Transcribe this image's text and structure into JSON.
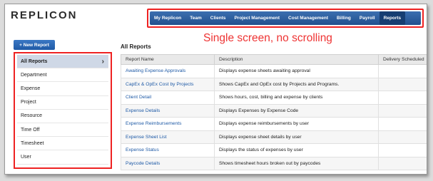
{
  "brand": {
    "logo_text": "REPLICON"
  },
  "nav": {
    "items": [
      {
        "label": "My Replicon"
      },
      {
        "label": "Team"
      },
      {
        "label": "Clients"
      },
      {
        "label": "Project Management"
      },
      {
        "label": "Cost Management"
      },
      {
        "label": "Billing"
      },
      {
        "label": "Payroll"
      },
      {
        "label": "Reports"
      }
    ],
    "active": "Reports"
  },
  "annotation": {
    "text": "Single screen, no scrolling"
  },
  "toolbar": {
    "new_report_label": "+ New Report"
  },
  "sidebar": {
    "items": [
      {
        "label": "All Reports"
      },
      {
        "label": "Department"
      },
      {
        "label": "Expense"
      },
      {
        "label": "Project"
      },
      {
        "label": "Resource"
      },
      {
        "label": "Time Off"
      },
      {
        "label": "Timesheet"
      },
      {
        "label": "User"
      }
    ]
  },
  "main": {
    "title": "All Reports",
    "columns": [
      "Report Name",
      "Description",
      "Delivery Scheduled"
    ],
    "rows": [
      {
        "name": "Awaiting Expense Approvals",
        "description": "Displays expense sheets awaiting approval"
      },
      {
        "name": "CapEx & OpEx Cost by Projects",
        "description": "Shows CapEx and OpEx cost by Projects and Programs."
      },
      {
        "name": "Client Detail",
        "description": "Shows hours, cost, billing and expense by clients"
      },
      {
        "name": "Expense Details",
        "description": "Displays Expenses by Expense Code"
      },
      {
        "name": "Expense Reimbursements",
        "description": "Displays expense reimbursements by user"
      },
      {
        "name": "Expense Sheet List",
        "description": "Displays expense sheet details by user"
      },
      {
        "name": "Expense Status",
        "description": "Displays the status of expenses by user"
      },
      {
        "name": "Paycode Details",
        "description": "Shows timesheet hours broken out by paycodes"
      }
    ]
  },
  "colors": {
    "nav_blue": "#2a5a9a",
    "highlight_red": "#e22222",
    "link_blue": "#1f5aa6"
  }
}
